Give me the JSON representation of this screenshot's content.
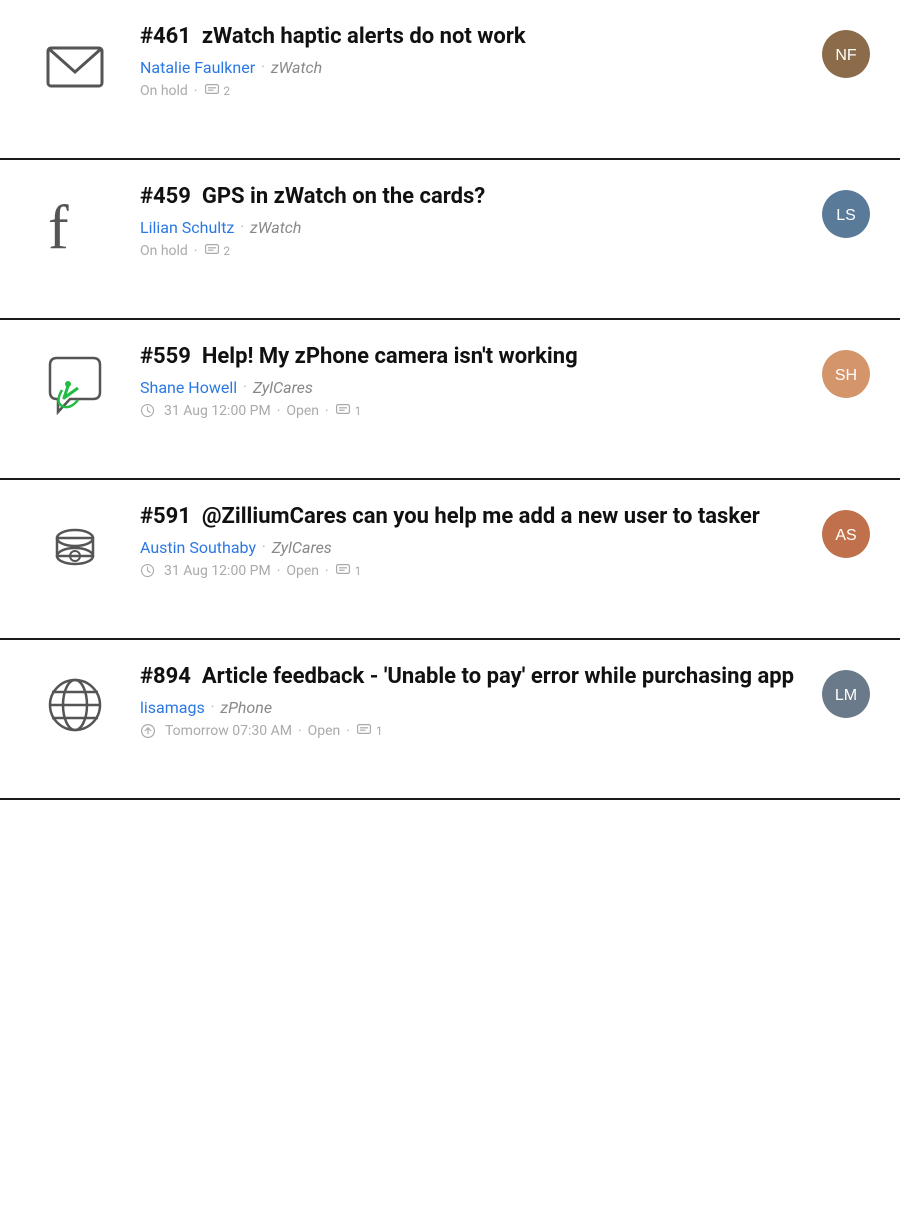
{
  "tickets": [
    {
      "id": "#461",
      "title": "zWatch haptic alerts do not work",
      "requester": "Natalie Faulkner",
      "product": "zWatch",
      "status": "On hold",
      "comments": "2",
      "time": null,
      "sla": false,
      "channel": "email",
      "avatar_class": "avatar-1",
      "avatar_initials": "NF"
    },
    {
      "id": "#459",
      "title": "GPS in zWatch on the cards?",
      "requester": "Lilian Schultz",
      "product": "zWatch",
      "status": "On hold",
      "comments": "2",
      "time": null,
      "sla": false,
      "channel": "facebook",
      "avatar_class": "avatar-2",
      "avatar_initials": "LS"
    },
    {
      "id": "#559",
      "title": "Help! My zPhone camera isn't working",
      "requester": "Shane Howell",
      "product": "ZylCares",
      "status": "Open",
      "comments": "1",
      "time": "31 Aug 12:00 PM",
      "sla": false,
      "channel": "chat",
      "avatar_class": "avatar-3",
      "avatar_initials": "SH"
    },
    {
      "id": "#591",
      "title": "@ZilliumCares can you help me add a new user to tasker",
      "requester": "Austin Southaby",
      "product": "ZylCares",
      "status": "Open",
      "comments": "1",
      "time": "31 Aug 12:00 PM",
      "sla": false,
      "channel": "phone",
      "avatar_class": "avatar-4",
      "avatar_initials": "AS"
    },
    {
      "id": "#894",
      "title": "Article feedback - 'Unable to pay' error while purchasing app",
      "requester": "lisamags",
      "product": "zPhone",
      "status": "Open",
      "comments": "1",
      "time": "Tomorrow 07:30 AM",
      "sla": true,
      "channel": "web",
      "avatar_class": "avatar-5",
      "avatar_initials": "LM"
    }
  ],
  "labels": {
    "dot": "·",
    "on_hold": "On hold",
    "open": "Open"
  }
}
